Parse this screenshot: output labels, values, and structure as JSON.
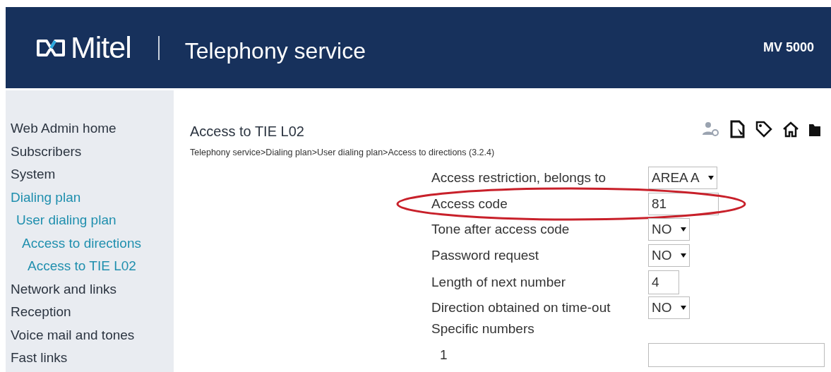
{
  "header": {
    "brand": "Mitel",
    "title": "Telephony service",
    "system": "MV 5000"
  },
  "sidebar": {
    "items": [
      {
        "label": "Web Admin home",
        "highlighted": false
      },
      {
        "label": "Subscribers",
        "highlighted": false
      },
      {
        "label": "System",
        "highlighted": false
      },
      {
        "label": "Dialing plan",
        "highlighted": true,
        "children": [
          {
            "label": "User dialing plan",
            "highlighted": true,
            "children": [
              {
                "label": "Access to directions",
                "highlighted": true,
                "children": [
                  {
                    "label": "Access to TIE L02",
                    "highlighted": true
                  }
                ]
              }
            ]
          }
        ]
      },
      {
        "label": "Network and links",
        "highlighted": false
      },
      {
        "label": "Reception",
        "highlighted": false
      },
      {
        "label": "Voice mail and tones",
        "highlighted": false
      },
      {
        "label": "Fast links",
        "highlighted": false
      }
    ]
  },
  "page": {
    "title": "Access to TIE L02",
    "breadcrumb": "Telephony service>Dialing plan>User dialing plan>Access to directions (3.2.4)"
  },
  "form": {
    "rows": [
      {
        "kind": "select",
        "label": "Access restriction, belongs to",
        "value": "AREA A",
        "circled": false
      },
      {
        "kind": "text",
        "label": "Access code",
        "value": "81",
        "circled": true
      },
      {
        "kind": "select",
        "label": "Tone after access code",
        "value": "NO",
        "circled": false
      },
      {
        "kind": "select",
        "label": "Password request",
        "value": "NO",
        "circled": false
      },
      {
        "kind": "number",
        "label": "Length of next number",
        "value": "4",
        "circled": false
      },
      {
        "kind": "select",
        "label": "Direction obtained on time-out",
        "value": "NO",
        "circled": false
      },
      {
        "kind": "heading",
        "label": "Specific numbers",
        "circled": false
      },
      {
        "kind": "wide",
        "label": "1",
        "value": "",
        "circled": false
      }
    ]
  }
}
